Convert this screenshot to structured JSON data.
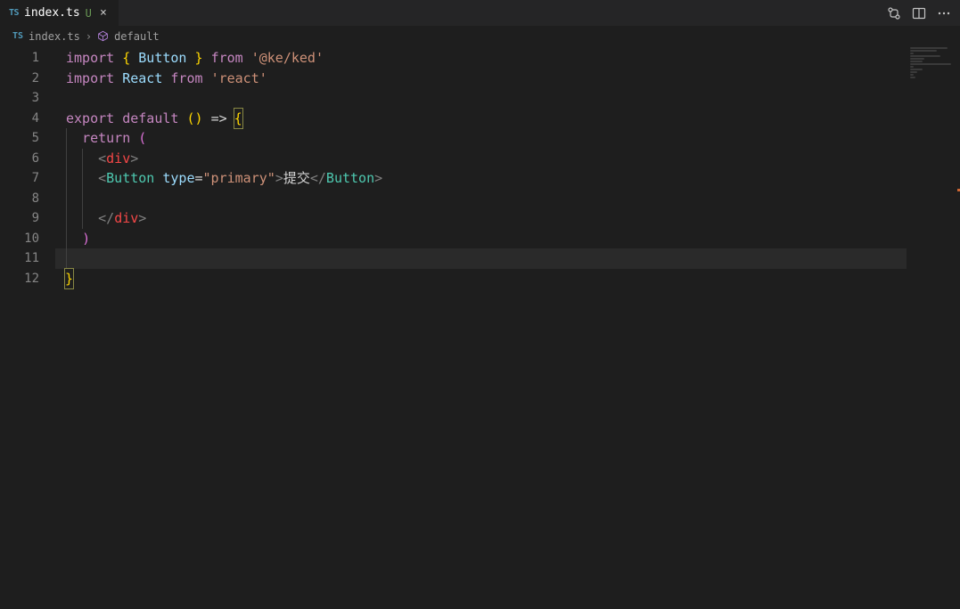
{
  "tab": {
    "icon_label": "TS",
    "filename": "index.ts",
    "dirty_marker": "U",
    "close_glyph": "×"
  },
  "breadcrumb": {
    "icon_label": "TS",
    "file": "index.ts",
    "separator": "›",
    "symbol": "default"
  },
  "line_numbers": [
    "1",
    "2",
    "3",
    "4",
    "5",
    "6",
    "7",
    "8",
    "9",
    "10",
    "11",
    "12"
  ],
  "code": {
    "l1": {
      "kw1": "import",
      "br1": "{",
      "ident": "Button",
      "br2": "}",
      "kw2": "from",
      "str": "'@ke/ked'"
    },
    "l2": {
      "kw1": "import",
      "ident": "React",
      "kw2": "from",
      "str": "'react'"
    },
    "l4": {
      "kw1": "export",
      "kw2": "default",
      "paren": "()",
      "arrow": "=>",
      "brace": "{"
    },
    "l5": {
      "kw": "return",
      "paren": "("
    },
    "l6": {
      "lt": "<",
      "tag": "div",
      "gt": ">"
    },
    "l7": {
      "lt": "<",
      "comp": "Button",
      "attr": "type",
      "eq": "=",
      "val": "\"primary\"",
      "gt1": ">",
      "text": "提交",
      "lts": "</",
      "comp2": "Button",
      "gt2": ">"
    },
    "l9": {
      "lts": "</",
      "tag": "div",
      "gt": ">"
    },
    "l10": {
      "paren": ")"
    },
    "l12": {
      "brace": "}"
    }
  },
  "current_line_index": 10
}
